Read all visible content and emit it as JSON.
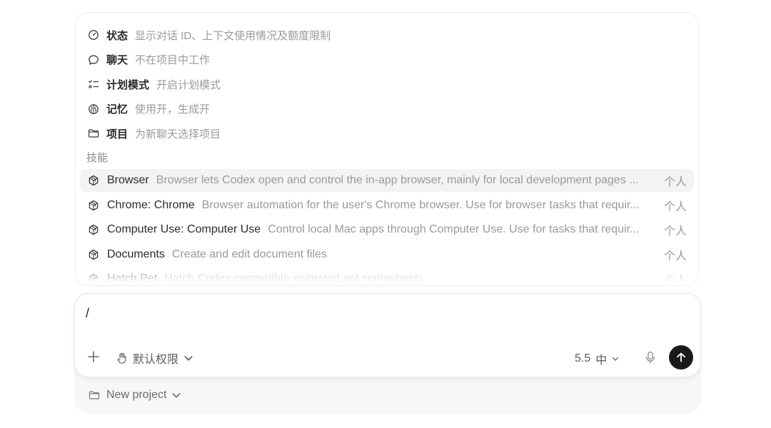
{
  "commands": [
    {
      "icon": "gauge-icon",
      "name": "状态",
      "desc": "显示对话 ID、上下文使用情况及额度限制"
    },
    {
      "icon": "chat-bubble-icon",
      "name": "聊天",
      "desc": "不在项目中工作"
    },
    {
      "icon": "checklist-icon",
      "name": "计划模式",
      "desc": "开启计划模式"
    },
    {
      "icon": "brain-icon",
      "name": "记忆",
      "desc": "使用开，生成开"
    },
    {
      "icon": "folder-icon",
      "name": "项目",
      "desc": "为新聊天选择项目"
    }
  ],
  "skills_label": "技能",
  "skills": [
    {
      "icon": "cube-icon",
      "name": "Browser",
      "desc": "Browser lets Codex open and control the in-app browser, mainly for local development pages ...",
      "scope": "个人",
      "selected": true
    },
    {
      "icon": "cube-icon",
      "name": "Chrome: Chrome",
      "desc": "Browser automation for the user's Chrome browser. Use for browser tasks that requir...",
      "scope": "个人"
    },
    {
      "icon": "cube-icon",
      "name": "Computer Use: Computer Use",
      "desc": "Control local Mac apps through Computer Use. Use for tasks that requir...",
      "scope": "个人"
    },
    {
      "icon": "cube-icon",
      "name": "Documents",
      "desc": "Create and edit document files",
      "scope": "个人"
    },
    {
      "icon": "cube-icon",
      "name": "Hatch Pet",
      "desc": "Hatch Codex-compatible animated pet spritesheets",
      "scope": "个人"
    }
  ],
  "composer": {
    "input_value": "/",
    "permission_label": "默认权限",
    "model_version": "5.5",
    "reasoning_mode": "中"
  },
  "project_label": "New project",
  "colors": {
    "send_button": "#1a1a1a",
    "selected_row": "#f3f3f3",
    "muted_text": "#9a9a9a"
  }
}
